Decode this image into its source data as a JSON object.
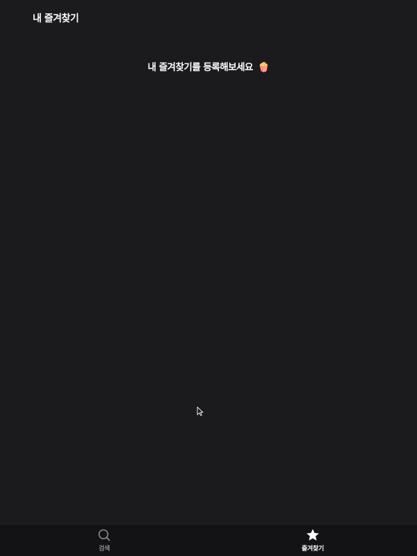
{
  "header": {
    "title": "내 즐겨찾기"
  },
  "main": {
    "empty_message": "내 즐겨찾기를 등록해보세요",
    "empty_emoji": "🍿"
  },
  "tabbar": {
    "tabs": [
      {
        "label": "검색",
        "icon": "search-icon",
        "active": false
      },
      {
        "label": "즐겨찾기",
        "icon": "star-icon",
        "active": true
      }
    ]
  },
  "colors": {
    "background": "#1b1a1d",
    "tabbar_background": "#131316",
    "active": "#ffffff",
    "inactive": "#8e8e93"
  }
}
